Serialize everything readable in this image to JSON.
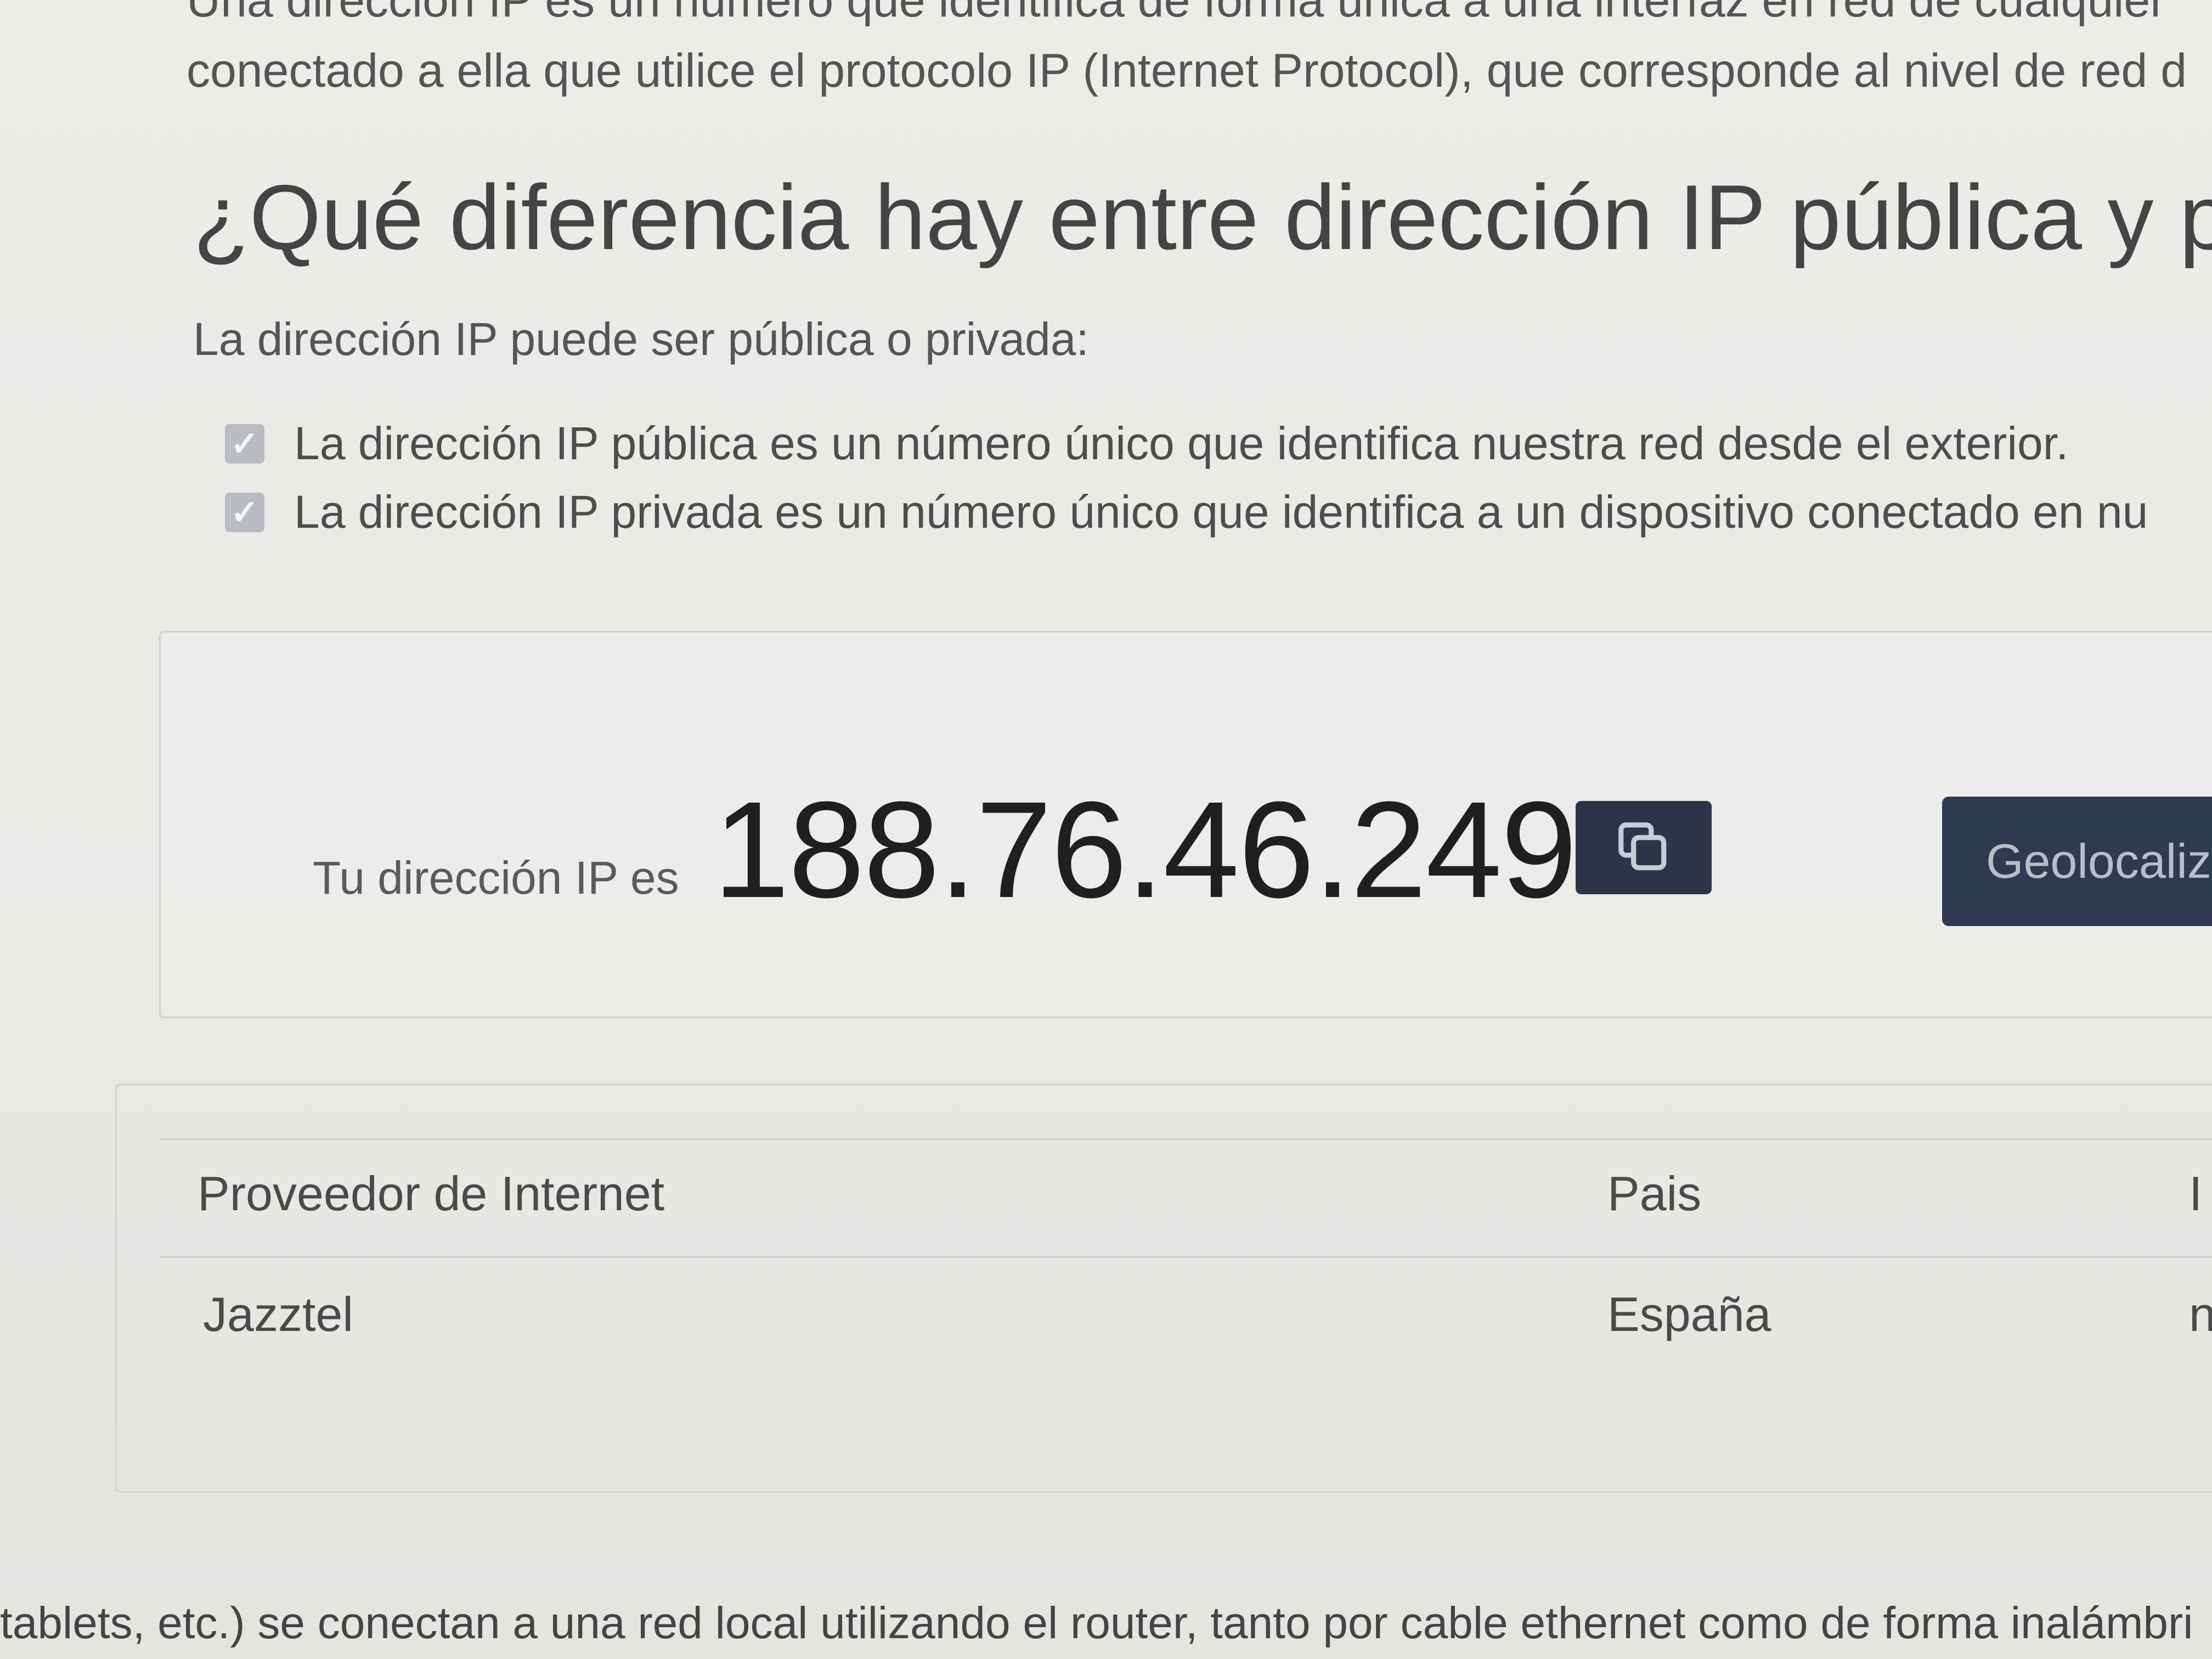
{
  "intro": {
    "line1": "Una dirección IP es un número que identifica de forma única a una interfaz en red de cualquier",
    "line2": "conectado a ella que utilice el protocolo IP (Internet Protocol), que corresponde al nivel de red d"
  },
  "section": {
    "heading": "¿Qué diferencia hay entre dirección IP pública y pri",
    "lead": "La dirección IP puede ser pública o privada:",
    "bullets": [
      {
        "text": "La dirección IP pública es un número único que identifica nuestra red desde el exterior."
      },
      {
        "text": "La dirección IP privada es un número único que identifica a un dispositivo conectado en nu"
      }
    ]
  },
  "ip_panel": {
    "label": "Tu dirección IP es",
    "ip_address": "188.76.46.249",
    "copy_icon": "copy-icon",
    "geo_button_label": "Geolocaliza"
  },
  "info_table": {
    "headers": [
      "Proveedor de Internet",
      "Pais",
      "I"
    ],
    "values": [
      "Jazztel",
      "España",
      "n"
    ]
  },
  "footer": {
    "text": "tablets, etc.) se conectan a una red local utilizando el router, tanto por cable ethernet como de forma inalámbri"
  },
  "colors": {
    "button_bg": "#2f3a52",
    "checkbox_bg": "#b9bcc2",
    "page_bg": "#e9e9e6"
  }
}
